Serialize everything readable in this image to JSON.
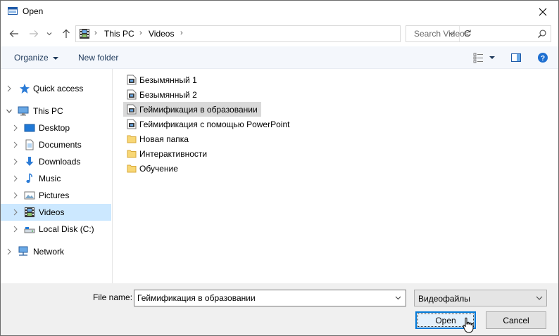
{
  "window": {
    "title": "Open"
  },
  "address": {
    "crumbs": [
      "This PC",
      "Videos"
    ]
  },
  "search": {
    "placeholder": "Search Videos"
  },
  "toolbar": {
    "organize": "Organize",
    "new_folder": "New folder"
  },
  "sidebar": {
    "items": [
      {
        "label": "Quick access",
        "icon": "star-icon",
        "level": 0
      },
      {
        "label": "This PC",
        "icon": "computer-icon",
        "level": 0
      },
      {
        "label": "Desktop",
        "icon": "desktop-icon",
        "level": 1
      },
      {
        "label": "Documents",
        "icon": "documents-icon",
        "level": 1
      },
      {
        "label": "Downloads",
        "icon": "download-icon",
        "level": 1
      },
      {
        "label": "Music",
        "icon": "music-icon",
        "level": 1
      },
      {
        "label": "Pictures",
        "icon": "pictures-icon",
        "level": 1
      },
      {
        "label": "Videos",
        "icon": "videos-icon",
        "level": 1,
        "selected": true
      },
      {
        "label": "Local Disk (C:)",
        "icon": "disk-icon",
        "level": 1
      },
      {
        "label": "Network",
        "icon": "network-icon",
        "level": 0
      }
    ]
  },
  "files": [
    {
      "name": "Безымянный 1",
      "type": "video"
    },
    {
      "name": "Безымянный 2",
      "type": "video"
    },
    {
      "name": "Геймификация в образовании",
      "type": "video",
      "highlight": true
    },
    {
      "name": "Геймификация с помощью PowerPoint",
      "type": "video"
    },
    {
      "name": "Новая папка",
      "type": "folder"
    },
    {
      "name": "Интерактивности",
      "type": "folder"
    },
    {
      "name": "Обучение",
      "type": "folder"
    }
  ],
  "bottom": {
    "file_name_label": "File name:",
    "file_name_value": "Геймификация в образовании",
    "file_type": "Видеофайлы",
    "open_label": "Open",
    "cancel_label": "Cancel"
  },
  "colors": {
    "selection": "#cce8ff",
    "toolbar_bg": "#f4f7fc",
    "primary_border": "#0078d7",
    "link_text": "#1e395b"
  }
}
